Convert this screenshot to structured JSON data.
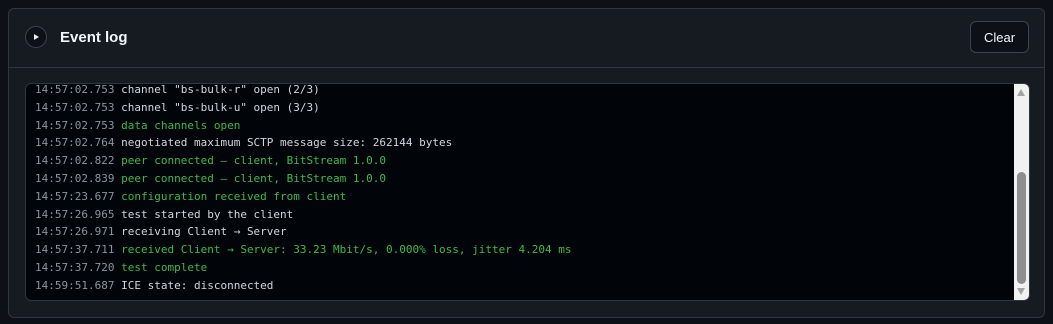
{
  "header": {
    "title": "Event log",
    "clear_label": "Clear",
    "toggle_icon": "play-triangle-icon"
  },
  "log": {
    "entries": [
      {
        "time": "14:57:02.753",
        "message": "channel \"bs-bulk-r\" open (2/3)",
        "status": "info"
      },
      {
        "time": "14:57:02.753",
        "message": "channel \"bs-bulk-u\" open (3/3)",
        "status": "info"
      },
      {
        "time": "14:57:02.753",
        "message": "data channels open",
        "status": "success"
      },
      {
        "time": "14:57:02.764",
        "message": "negotiated maximum SCTP message size: 262144 bytes",
        "status": "info"
      },
      {
        "time": "14:57:02.822",
        "message": "peer connected — client, BitStream 1.0.0",
        "status": "success"
      },
      {
        "time": "14:57:02.839",
        "message": "peer connected — client, BitStream 1.0.0",
        "status": "success"
      },
      {
        "time": "14:57:23.677",
        "message": "configuration received from client",
        "status": "success"
      },
      {
        "time": "14:57:26.965",
        "message": "test started by the client",
        "status": "info"
      },
      {
        "time": "14:57:26.971",
        "message": "receiving Client → Server",
        "status": "info"
      },
      {
        "time": "14:57:37.711",
        "message": "received Client → Server: 33.23 Mbit/s, 0.000% loss, jitter 4.204 ms",
        "status": "success"
      },
      {
        "time": "14:57:37.720",
        "message": "test complete",
        "status": "success"
      },
      {
        "time": "14:59:51.687",
        "message": "ICE state: disconnected",
        "status": "info"
      }
    ]
  },
  "colors": {
    "timestamp": "#8b949e",
    "info": "#d0d7de",
    "success": "#3fb950"
  },
  "scroll": {
    "position_fraction": 1.0
  }
}
